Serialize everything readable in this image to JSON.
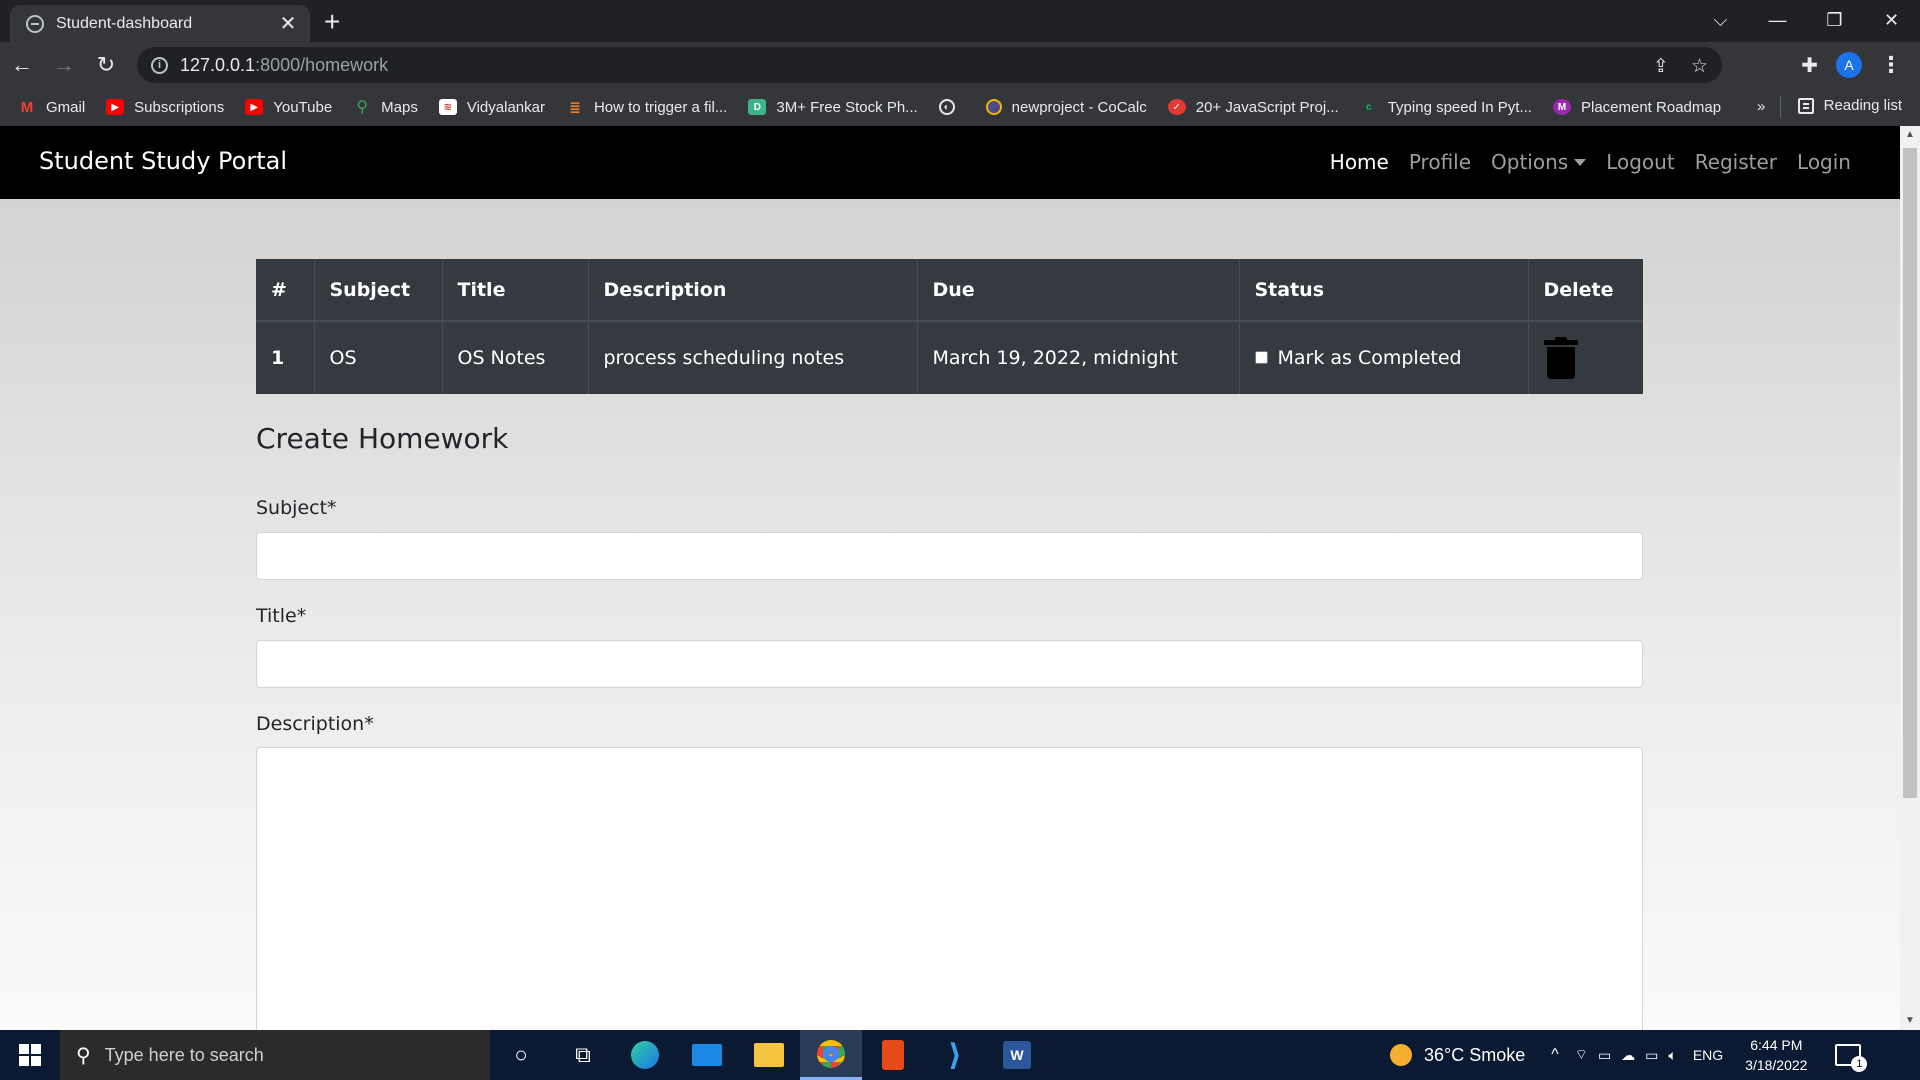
{
  "browser": {
    "tab_title": "Student-dashboard",
    "url_host": "127.0.0.1",
    "url_path": ":8000/homework",
    "profile_initial": "A",
    "bookmarks": [
      {
        "label": "Gmail",
        "icon": "gmail-icon",
        "color": "#ea4335"
      },
      {
        "label": "Subscriptions",
        "icon": "youtube-icon",
        "color": "#ff0000"
      },
      {
        "label": "YouTube",
        "icon": "youtube-icon",
        "color": "#ff0000"
      },
      {
        "label": "Maps",
        "icon": "maps-icon",
        "color": "#34a853"
      },
      {
        "label": "Vidyalankar",
        "icon": "vidyalankar-icon",
        "color": "#c0392b"
      },
      {
        "label": "How to trigger a fil...",
        "icon": "stackoverflow-icon",
        "color": "#f48024"
      },
      {
        "label": "3M+ Free Stock Ph...",
        "icon": "stock-photo-icon",
        "color": "#3db389"
      },
      {
        "label": "",
        "icon": "globe-icon",
        "color": "#e8eaed"
      },
      {
        "label": "newproject - CoCalc",
        "icon": "cocalc-icon",
        "color": "#f4b400"
      },
      {
        "label": "20+ JavaScript Proj...",
        "icon": "js-project-icon",
        "color": "#e53935"
      },
      {
        "label": "Typing speed In Pyt...",
        "icon": "c-icon",
        "color": "#00c853"
      },
      {
        "label": "Placement Roadmap",
        "icon": "roadmap-icon",
        "color": "#9c27b0"
      }
    ],
    "more_label": "»",
    "reading_list_label": "Reading list"
  },
  "navbar": {
    "brand": "Student Study Portal",
    "links": [
      "Home",
      "Profile",
      "Options",
      "Logout",
      "Register",
      "Login"
    ]
  },
  "table": {
    "headers": [
      "#",
      "Subject",
      "Title",
      "Description",
      "Due",
      "Status",
      "Delete"
    ],
    "rows": [
      {
        "num": "1",
        "subject": "OS",
        "title": "OS Notes",
        "description": "process scheduling notes",
        "due": "March 19, 2022, midnight",
        "status": "Mark as Completed"
      }
    ]
  },
  "form": {
    "heading": "Create Homework",
    "subject_label": "Subject*",
    "title_label": "Title*",
    "description_label": "Description*"
  },
  "taskbar": {
    "search_placeholder": "Type here to search",
    "weather": "36°C  Smoke",
    "lang": "ENG",
    "time": "6:44 PM",
    "date": "3/18/2022",
    "notification_count": "1"
  },
  "colors": {
    "navbar_bg": "#000000",
    "table_bg": "#343a40",
    "taskbar_bg": "#0b1a33"
  }
}
